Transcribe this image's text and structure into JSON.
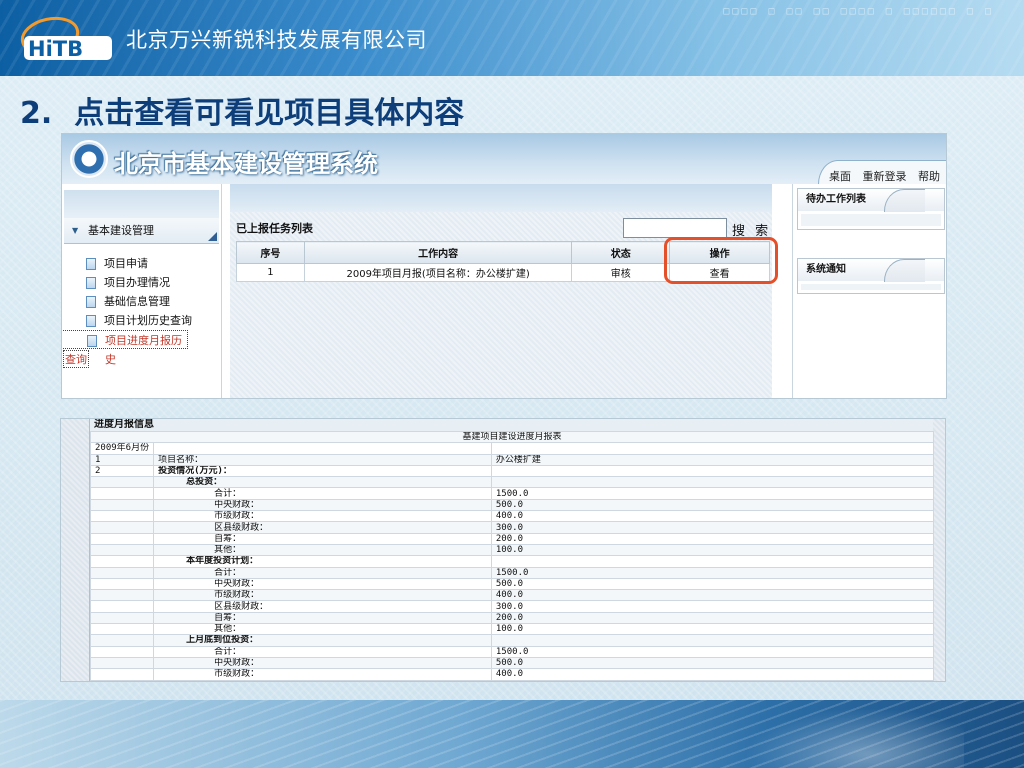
{
  "slide": {
    "company": "北京万兴新锐科技发展有限公司",
    "logo_text": "HiTB",
    "banner_deco": "□□□□ □ □□ □□ □□□□ □ □□□□□□ □ □",
    "heading_number": "2.",
    "heading": "点击查看可看见项目具体内容"
  },
  "system": {
    "title": "北京市基本建设管理系统",
    "top_links": [
      "桌面",
      "重新登录",
      "帮助"
    ],
    "nav": {
      "section": "基本建设管理",
      "items": [
        "项目申请",
        "项目办理情况",
        "基础信息管理",
        "项目计划历史查询",
        "项目进度月报历史"
      ],
      "active_wrap": "查询"
    },
    "task_list": {
      "title": "已上报任务列表",
      "search_label": "搜 索",
      "headers": [
        "序号",
        "工作内容",
        "状态",
        "操作"
      ],
      "rows": [
        {
          "no": "1",
          "content": "2009年项目月报(项目名称：办公楼扩建)",
          "status": "审核",
          "action": "查看"
        }
      ]
    },
    "right": {
      "pending": "待办工作列表",
      "notice": "系统通知"
    }
  },
  "report": {
    "section_title": "进度月报信息",
    "rows": [
      {
        "c0": "",
        "c1": "",
        "c2": "基建项目建设进度月报表",
        "lv": 0,
        "bold": false,
        "span": true
      },
      {
        "c0": "2009年6月份",
        "c1": "",
        "c2": "",
        "lv": 0,
        "bold": false
      },
      {
        "c0": "1",
        "c1": "项目名称：",
        "c2": "办公楼扩建",
        "lv": 1,
        "bold": false
      },
      {
        "c0": "2",
        "c1": "投资情况(万元)：",
        "c2": "",
        "lv": 1,
        "bold": true
      },
      {
        "c0": "",
        "c1": "总投资：",
        "c2": "",
        "lv": 2,
        "bold": true
      },
      {
        "c0": "",
        "c1": "合计：",
        "c2": "1500.0",
        "lv": 3,
        "bold": false
      },
      {
        "c0": "",
        "c1": "中央财政：",
        "c2": "500.0",
        "lv": 3,
        "bold": false
      },
      {
        "c0": "",
        "c1": "市级财政：",
        "c2": "400.0",
        "lv": 3,
        "bold": false
      },
      {
        "c0": "",
        "c1": "区县级财政：",
        "c2": "300.0",
        "lv": 3,
        "bold": false
      },
      {
        "c0": "",
        "c1": "自筹：",
        "c2": "200.0",
        "lv": 3,
        "bold": false
      },
      {
        "c0": "",
        "c1": "其他：",
        "c2": "100.0",
        "lv": 3,
        "bold": false
      },
      {
        "c0": "",
        "c1": "本年度投资计划：",
        "c2": "",
        "lv": 2,
        "bold": true
      },
      {
        "c0": "",
        "c1": "合计：",
        "c2": "1500.0",
        "lv": 3,
        "bold": false
      },
      {
        "c0": "",
        "c1": "中央财政：",
        "c2": "500.0",
        "lv": 3,
        "bold": false
      },
      {
        "c0": "",
        "c1": "市级财政：",
        "c2": "400.0",
        "lv": 3,
        "bold": false
      },
      {
        "c0": "",
        "c1": "区县级财政：",
        "c2": "300.0",
        "lv": 3,
        "bold": false
      },
      {
        "c0": "",
        "c1": "自筹：",
        "c2": "200.0",
        "lv": 3,
        "bold": false
      },
      {
        "c0": "",
        "c1": "其他：",
        "c2": "100.0",
        "lv": 3,
        "bold": false
      },
      {
        "c0": "",
        "c1": "上月底到位投资：",
        "c2": "",
        "lv": 2,
        "bold": true
      },
      {
        "c0": "",
        "c1": "合计：",
        "c2": "1500.0",
        "lv": 3,
        "bold": false
      },
      {
        "c0": "",
        "c1": "中央财政：",
        "c2": "500.0",
        "lv": 3,
        "bold": false
      },
      {
        "c0": "",
        "c1": "市级财政：",
        "c2": "400.0",
        "lv": 3,
        "bold": false
      }
    ]
  },
  "colors": {
    "highlight": "#e4502a",
    "heading": "#0d3e7a",
    "active_nav": "#c0392b"
  }
}
